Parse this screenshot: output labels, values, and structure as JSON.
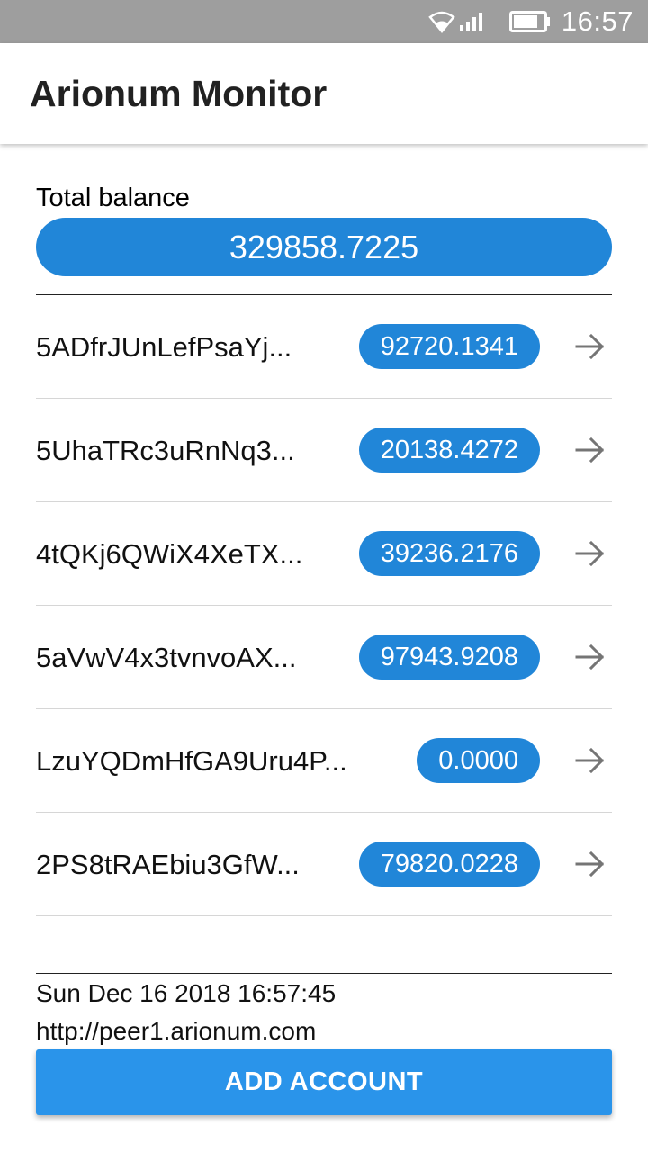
{
  "status_bar": {
    "time": "16:57"
  },
  "app": {
    "title": "Arionum Monitor"
  },
  "total": {
    "label": "Total balance",
    "value": "329858.7225"
  },
  "accounts": [
    {
      "address": "5ADfrJUnLefPsaYj...",
      "balance": "92720.1341"
    },
    {
      "address": "5UhaTRc3uRnNq3...",
      "balance": "20138.4272"
    },
    {
      "address": "4tQKj6QWiX4XeTX...",
      "balance": "39236.2176"
    },
    {
      "address": "5aVwV4x3tvnvoAX...",
      "balance": "97943.9208"
    },
    {
      "address": "LzuYQDmHfGA9Uru4P...",
      "balance": "0.0000"
    },
    {
      "address": "2PS8tRAEbiu3GfW...",
      "balance": "79820.0228"
    }
  ],
  "footer": {
    "timestamp": "Sun Dec 16 2018 16:57:45",
    "peer": "http://peer1.arionum.com"
  },
  "add_button": {
    "label": "ADD ACCOUNT"
  },
  "colors": {
    "accent": "#2186d8",
    "button": "#2a94ea",
    "status_bar": "#9e9e9e"
  }
}
